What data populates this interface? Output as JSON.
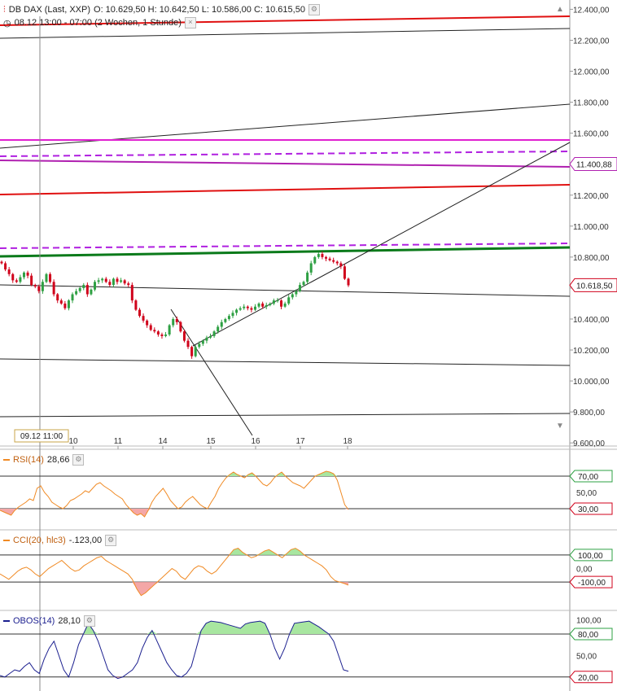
{
  "header": {
    "title": "DB DAX (Last, XXP)",
    "ohlc": "O: 10.629,50  H: 10.642,50  L: 10.586,00  C: 10.615,50",
    "period": "08.12 13:00 - 07:00 (2 Wochen, 1 Stunde)"
  },
  "crosshair_label": "09.12 11:00",
  "colors": {
    "up": "#2ea043",
    "down": "#d0021b",
    "rsi": "#f08a24",
    "cci": "#f08a24",
    "obos": "#1b1f8f",
    "green_fill": "#a8e6a0",
    "red_fill": "#f4a7a7"
  },
  "chart_data": [
    {
      "type": "candlestick",
      "title": "DB DAX (Last, XXP)",
      "x_ticks": [
        "10",
        "11",
        "14",
        "15",
        "16",
        "17",
        "18"
      ],
      "y_ticks": [
        "12.400,00",
        "12.200,00",
        "12.000,00",
        "11.800,00",
        "11.600,00",
        "11.400,00",
        "11.200,00",
        "11.000,00",
        "10.800,00",
        "10.600,00",
        "10.400,00",
        "10.200,00",
        "10.000,00",
        "9.800,00",
        "9.600,00"
      ],
      "ylim": [
        9580,
        12460
      ],
      "price_labels": [
        "11.400,88",
        "10.618,50"
      ],
      "close_series": [
        10760,
        10720,
        10690,
        10650,
        10640,
        10670,
        10700,
        10680,
        10620,
        10610,
        10580,
        10640,
        10690,
        10640,
        10560,
        10520,
        10500,
        10470,
        10520,
        10560,
        10580,
        10600,
        10620,
        10560,
        10590,
        10640,
        10650,
        10660,
        10640,
        10620,
        10660,
        10640,
        10650,
        10630,
        10620,
        10520,
        10460,
        10420,
        10390,
        10360,
        10330,
        10320,
        10300,
        10290,
        10300,
        10360,
        10400,
        10380,
        10320,
        10260,
        10220,
        10160,
        10220,
        10240,
        10260,
        10280,
        10290,
        10320,
        10350,
        10380,
        10400,
        10420,
        10440,
        10460,
        10470,
        10480,
        10470,
        10460,
        10480,
        10500,
        10480,
        10490,
        10500,
        10520,
        10520,
        10480,
        10500,
        10540,
        10560,
        10580,
        10620,
        10640,
        10700,
        10760,
        10800,
        10820,
        10800,
        10790,
        10780,
        10770,
        10760,
        10740,
        10660,
        10618
      ]
    },
    {
      "type": "line",
      "title": "RSI(14)",
      "value": "28,66",
      "levels": [
        "70,00",
        "50,00",
        "30,00"
      ],
      "ylim": [
        10,
        90
      ],
      "values": [
        28,
        26,
        24,
        22,
        28,
        32,
        35,
        38,
        42,
        40,
        55,
        58,
        50,
        45,
        38,
        35,
        32,
        30,
        34,
        40,
        42,
        45,
        48,
        52,
        50,
        55,
        60,
        62,
        58,
        55,
        52,
        48,
        45,
        42,
        35,
        30,
        25,
        22,
        24,
        20,
        28,
        38,
        45,
        50,
        55,
        48,
        40,
        35,
        30,
        32,
        38,
        42,
        45,
        40,
        35,
        32,
        30,
        38,
        45,
        55,
        62,
        68,
        72,
        75,
        72,
        70,
        68,
        72,
        74,
        70,
        65,
        60,
        58,
        62,
        68,
        72,
        75,
        70,
        66,
        62,
        60,
        58,
        55,
        60,
        65,
        70,
        72,
        74,
        76,
        75,
        73,
        65,
        50,
        35,
        29
      ]
    },
    {
      "type": "line",
      "title": "CCI(20, hlc3)",
      "value": "-.123,00",
      "levels": [
        "100,00",
        "0,00",
        "-100,00"
      ],
      "ylim": [
        -280,
        220
      ],
      "values": [
        -40,
        -60,
        -80,
        -50,
        -20,
        0,
        10,
        -10,
        -40,
        -60,
        -30,
        0,
        20,
        40,
        60,
        30,
        0,
        -20,
        -10,
        20,
        40,
        60,
        80,
        90,
        60,
        40,
        20,
        0,
        -20,
        -40,
        -80,
        -150,
        -200,
        -180,
        -150,
        -120,
        -90,
        -60,
        -30,
        0,
        -20,
        -60,
        -80,
        -40,
        0,
        20,
        10,
        -20,
        -40,
        -20,
        20,
        60,
        100,
        140,
        150,
        120,
        100,
        80,
        90,
        110,
        130,
        140,
        120,
        100,
        80,
        110,
        140,
        150,
        130,
        100,
        80,
        60,
        40,
        20,
        -10,
        -60,
        -90,
        -100,
        -110,
        -123
      ]
    },
    {
      "type": "line",
      "title": "OBOS(14)",
      "value": "28,10",
      "levels": [
        "100,00",
        "80,00",
        "50,00",
        "20,00"
      ],
      "ylim": [
        5,
        105
      ],
      "values": [
        22,
        20,
        25,
        30,
        28,
        35,
        40,
        30,
        25,
        45,
        60,
        70,
        50,
        30,
        20,
        40,
        65,
        80,
        95,
        85,
        70,
        50,
        30,
        22,
        18,
        20,
        25,
        30,
        40,
        60,
        75,
        85,
        70,
        55,
        40,
        30,
        22,
        20,
        25,
        35,
        60,
        85,
        95,
        98,
        97,
        96,
        94,
        92,
        90,
        88,
        94,
        96,
        97,
        98,
        95,
        80,
        60,
        45,
        60,
        80,
        95,
        96,
        97,
        98,
        94,
        90,
        85,
        80,
        70,
        50,
        30,
        28
      ]
    }
  ]
}
